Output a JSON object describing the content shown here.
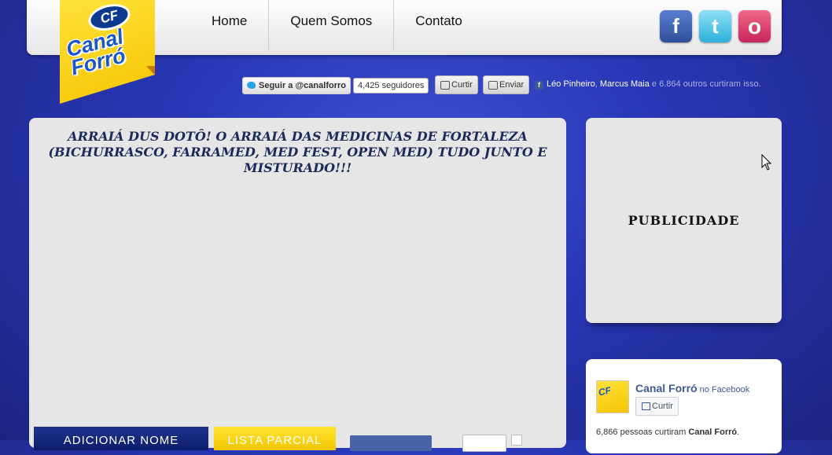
{
  "header": {
    "logo_badge": "CF",
    "logo_line1": "Canal",
    "logo_line2": "Forró",
    "nav": [
      {
        "label": "Home"
      },
      {
        "label": "Quem Somos"
      },
      {
        "label": "Contato"
      }
    ],
    "social": {
      "facebook_icon": "f",
      "twitter_icon": "t",
      "instagram_icon": "o"
    }
  },
  "social_strip": {
    "twitter_follow": "Seguir a @canalforro",
    "twitter_count": "4,425 seguidores",
    "like_label": "Curtir",
    "send_label": "Enviar",
    "friends": [
      "Léo Pinheiro",
      "Marcus Maia"
    ],
    "others_text": " e 6.864 outros curtiram isso.",
    "fb_icon": "f"
  },
  "post": {
    "title": "ARRAIÁ DUS DOTÔ! O ARRAIÁ DAS MEDICINAS DE FORTALEZA (BICHURRASCO, FARRAMED, MED FEST, OPEN MED) TUDO JUNTO E MISTURADO!!!",
    "add_name_label": "ADICIONAR NOME",
    "partial_list_label": "LISTA PARCIAL"
  },
  "sidebar": {
    "ad_label": "PUBLICIDADE",
    "fb_box": {
      "page_name": "Canal Forró",
      "page_suffix": " no Facebook",
      "like_label": "Curtir",
      "count_text": "6,866 pessoas curtiram ",
      "count_name": "Canal Forró",
      "count_end": "."
    }
  }
}
